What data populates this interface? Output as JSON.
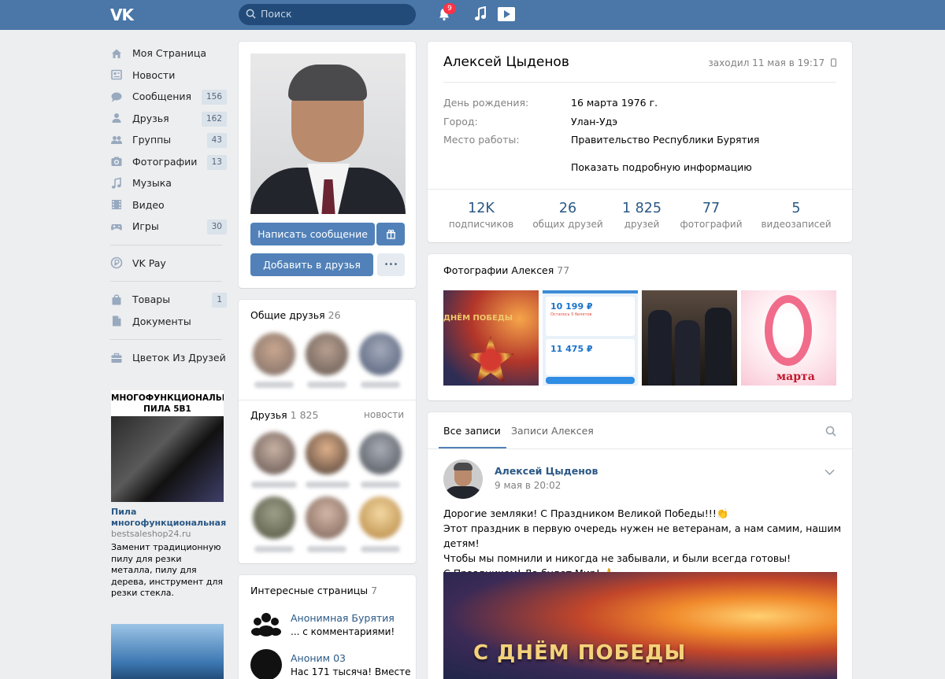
{
  "header": {
    "logo": "VK",
    "search_placeholder": "Поиск",
    "notifications_count": "9"
  },
  "menu": [
    {
      "label": "Моя Страница",
      "icon": "home-icon",
      "count": ""
    },
    {
      "label": "Новости",
      "icon": "news-icon",
      "count": ""
    },
    {
      "label": "Сообщения",
      "icon": "message-icon",
      "count": "156"
    },
    {
      "label": "Друзья",
      "icon": "user-icon",
      "count": "162"
    },
    {
      "label": "Группы",
      "icon": "group-icon",
      "count": "43"
    },
    {
      "label": "Фотографии",
      "icon": "camera-icon",
      "count": "13"
    },
    {
      "label": "Музыка",
      "icon": "music-icon",
      "count": ""
    },
    {
      "label": "Видео",
      "icon": "video-icon",
      "count": ""
    },
    {
      "label": "Игры",
      "icon": "gamepad-icon",
      "count": "30"
    }
  ],
  "menu2": [
    {
      "label": "VK Pay",
      "icon": "vkpay-icon",
      "count": ""
    }
  ],
  "menu3": [
    {
      "label": "Товары",
      "icon": "bag-icon",
      "count": "1"
    },
    {
      "label": "Документы",
      "icon": "document-icon",
      "count": ""
    }
  ],
  "menu4": [
    {
      "label": "Цветок Из Друзей",
      "icon": "briefcase-icon",
      "count": ""
    }
  ],
  "ad": {
    "banner_line1": "МНОГОФУНКЦИОНАЛЬНАЯ",
    "banner_line2": "ПИЛА 5В1",
    "title": "Пила многофункциональная",
    "site": "bestsaleshop24.ru",
    "description": "Заменит традиционную пилу для резки металла, пилу для дерева, инструмент для резки стекла."
  },
  "profile_actions": {
    "write_message": "Написать сообщение",
    "add_friend": "Добавить в друзья",
    "more": "•••"
  },
  "common_friends": {
    "title": "Общие друзья",
    "count": "26"
  },
  "friends": {
    "title": "Друзья",
    "count": "1 825",
    "link": "новости"
  },
  "interesting": {
    "title": "Интересные страницы",
    "count": "7",
    "items": [
      {
        "name": "Анонимная Бурятия",
        "sub": "... с комментариями!"
      },
      {
        "name": "Аноним 03",
        "sub": "Нас 171 тысяча! Вместе"
      }
    ]
  },
  "profile": {
    "name": "Алексей Цыденов",
    "last_seen": "заходил 11 мая в 19:17",
    "rows": [
      {
        "key": "День рождения:",
        "value": "16 марта 1976 г."
      },
      {
        "key": "Город:",
        "value": "Улан-Удэ"
      },
      {
        "key": "Место работы:",
        "value": "Правительство Республики Бурятия"
      }
    ],
    "more": "Показать подробную информацию",
    "stats": [
      {
        "num": "12K",
        "label": "подписчиков"
      },
      {
        "num": "26",
        "label": "общих друзей"
      },
      {
        "num": "1 825",
        "label": "друзей"
      },
      {
        "num": "77",
        "label": "фотографий"
      },
      {
        "num": "5",
        "label": "видеозаписей"
      }
    ]
  },
  "photos": {
    "title": "Фотографии Алексея",
    "count": "77",
    "thumb1_text": "ДНЁМ ПОБЕДЫ",
    "thumb2_price1": "10 199 ₽",
    "thumb2_price2": "11 475 ₽",
    "thumb2_sub": "Осталось 5 билетов",
    "thumb4_text": "марта"
  },
  "wall": {
    "tab_all": "Все записи",
    "tab_own": "Записи Алексея",
    "post": {
      "author": "Алексей Цыденов",
      "date": "9 мая в 20:02",
      "lines": [
        "Дорогие земляки! С Праздником Великой Победы!!!👏",
        "Этот праздник в первую очередь нужен не ветеранам, а нам самим, нашим детям!",
        "Чтобы мы помнили и никогда не забывали, и были всегда готовы!",
        "С Праздником! Да будет Мир! 🙏"
      ],
      "image_title": "С ДНЁМ ПОБЕДЫ"
    }
  }
}
